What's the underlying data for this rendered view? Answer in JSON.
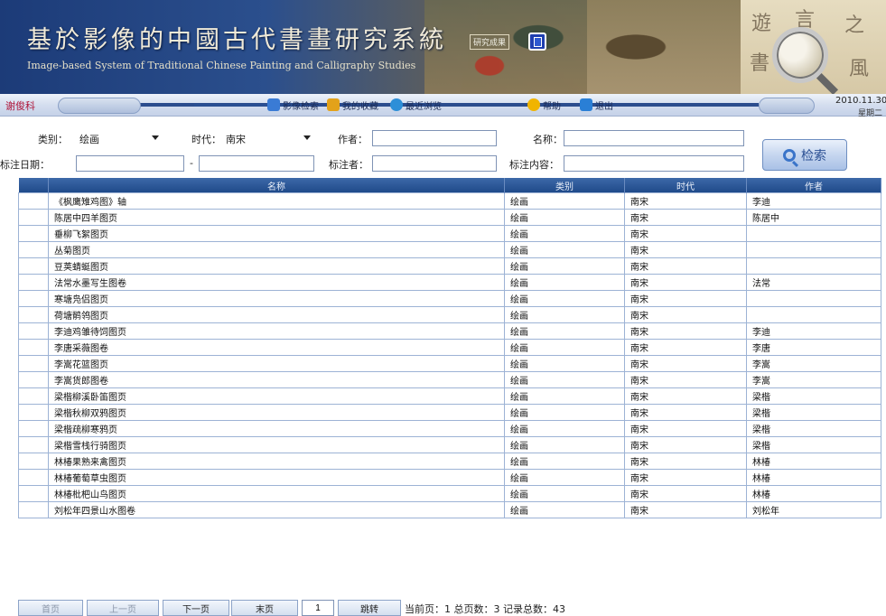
{
  "header": {
    "title_cn": "基於影像的中國古代書畫研究系統",
    "title_en": "Image-based System of Traditional Chinese Painting and Calligraphy Studies",
    "seal_text": "研究成果"
  },
  "nav": {
    "user": "谢俊科",
    "items": [
      {
        "label": "影像检索",
        "icon": "image-search-icon",
        "color": "#3a7bd5"
      },
      {
        "label": "我的收藏",
        "icon": "star-folder-icon",
        "color": "#e3a21a"
      },
      {
        "label": "最近浏览",
        "icon": "history-icon",
        "color": "#2d8fd8"
      },
      {
        "label": "帮助",
        "icon": "help-icon",
        "color": "#f0b400"
      },
      {
        "label": "退出",
        "icon": "exit-icon",
        "color": "#2a7fd6"
      }
    ],
    "date": "2010.11.30",
    "weekday": "星期二"
  },
  "form": {
    "category_label": "类别：",
    "category_value": "绘画",
    "era_label": "时代：",
    "era_value": "南宋",
    "author_label": "作者：",
    "author_value": "",
    "name_label": "名称：",
    "name_value": "",
    "date_label": "标注日期：",
    "date_separator": "-",
    "annotator_label": "标注者：",
    "content_label": "标注内容：",
    "search_label": "检索"
  },
  "table": {
    "headers": [
      "",
      "名称",
      "类别",
      "时代",
      "作者"
    ],
    "rows": [
      {
        "name": "《枫鹰雉鸡图》轴",
        "category": "绘画",
        "era": "南宋",
        "author": "李迪"
      },
      {
        "name": "陈居中四羊图页",
        "category": "绘画",
        "era": "南宋",
        "author": "陈居中"
      },
      {
        "name": "垂柳飞絮图页",
        "category": "绘画",
        "era": "南宋",
        "author": ""
      },
      {
        "name": "丛菊图页",
        "category": "绘画",
        "era": "南宋",
        "author": ""
      },
      {
        "name": "豆荚蜻蜓图页",
        "category": "绘画",
        "era": "南宋",
        "author": ""
      },
      {
        "name": "法常水墨写生图卷",
        "category": "绘画",
        "era": "南宋",
        "author": "法常"
      },
      {
        "name": "寒塘凫侣图页",
        "category": "绘画",
        "era": "南宋",
        "author": ""
      },
      {
        "name": "荷塘鹡鸰图页",
        "category": "绘画",
        "era": "南宋",
        "author": ""
      },
      {
        "name": "李迪鸡雏待饲图页",
        "category": "绘画",
        "era": "南宋",
        "author": "李迪"
      },
      {
        "name": "李唐采薇图卷",
        "category": "绘画",
        "era": "南宋",
        "author": "李唐"
      },
      {
        "name": "李嵩花篮图页",
        "category": "绘画",
        "era": "南宋",
        "author": "李嵩"
      },
      {
        "name": "李嵩货郎图卷",
        "category": "绘画",
        "era": "南宋",
        "author": "李嵩"
      },
      {
        "name": "梁楷柳溪卧笛图页",
        "category": "绘画",
        "era": "南宋",
        "author": "梁楷"
      },
      {
        "name": "梁楷秋柳双鸦图页",
        "category": "绘画",
        "era": "南宋",
        "author": "梁楷"
      },
      {
        "name": "梁楷疏柳寒鸦页",
        "category": "绘画",
        "era": "南宋",
        "author": "梁楷"
      },
      {
        "name": "梁楷雪栈行骑图页",
        "category": "绘画",
        "era": "南宋",
        "author": "梁楷"
      },
      {
        "name": "林椿果熟来禽图页",
        "category": "绘画",
        "era": "南宋",
        "author": "林椿"
      },
      {
        "name": "林椿葡萄草虫图页",
        "category": "绘画",
        "era": "南宋",
        "author": "林椿"
      },
      {
        "name": "林椿枇杷山鸟图页",
        "category": "绘画",
        "era": "南宋",
        "author": "林椿"
      },
      {
        "name": "刘松年四景山水图卷",
        "category": "绘画",
        "era": "南宋",
        "author": "刘松年"
      }
    ]
  },
  "pager": {
    "first": "首页",
    "prev": "上一页",
    "next": "下一页",
    "last": "末页",
    "page_value": "1",
    "go": "跳转",
    "info": "当前页：1  总页数：3  记录总数：43"
  }
}
